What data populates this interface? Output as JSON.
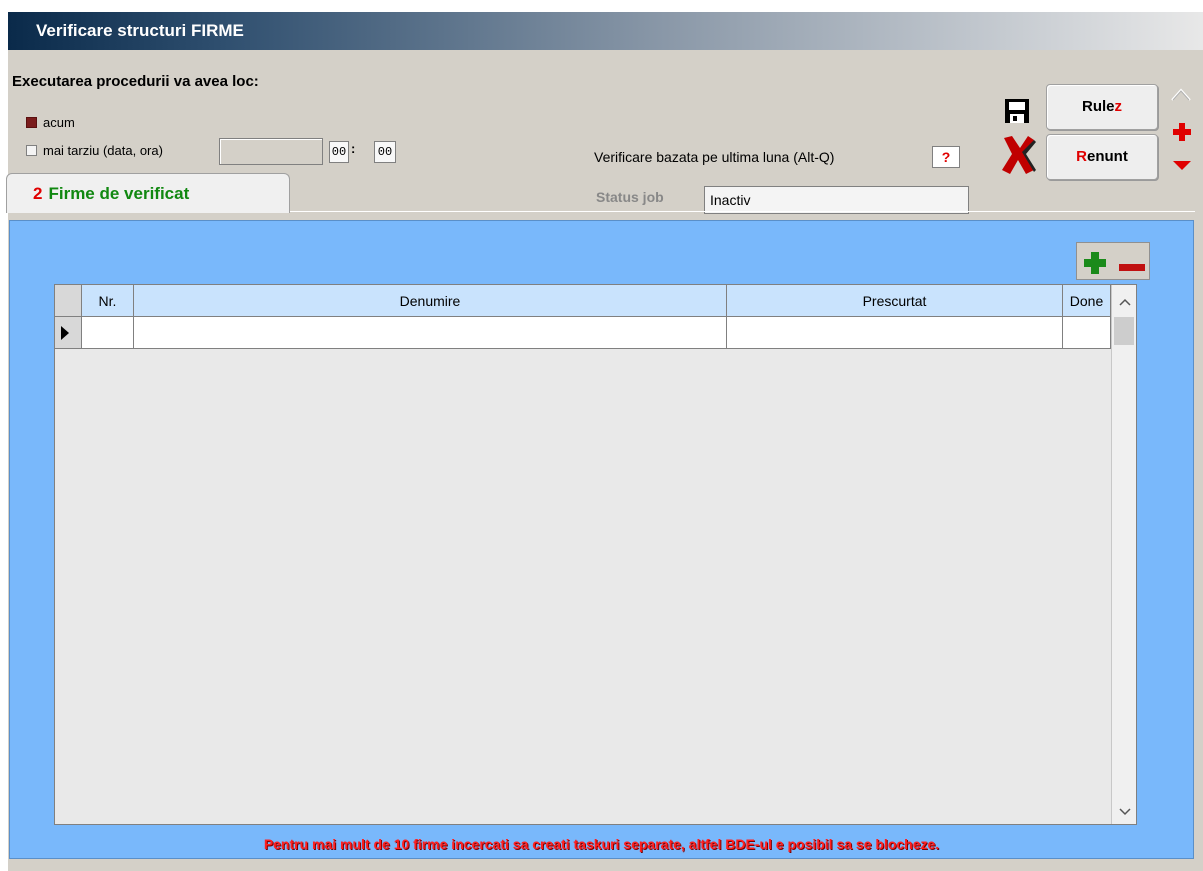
{
  "window": {
    "title": "Verificare structuri FIRME"
  },
  "schedule": {
    "heading": "Executarea procedurii va avea loc:",
    "option_now": "acum",
    "option_later": "mai tarziu (data, ora)",
    "date_value": "",
    "hour_value": "00",
    "minute_value": "00"
  },
  "verification": {
    "label": "Verificare bazata pe ultima luna (Alt-Q)",
    "value": "?"
  },
  "status": {
    "label": "Status job",
    "value": "Inactiv"
  },
  "buttons": {
    "run": {
      "main": "Rule",
      "hotkey": "z"
    },
    "cancel": {
      "hotkey": "R",
      "main": "enunt"
    }
  },
  "tab": {
    "number": "2",
    "label": "Firme de verificat"
  },
  "grid": {
    "columns": [
      "Nr.",
      "Denumire",
      "Prescurtat",
      "Done"
    ],
    "rows": []
  },
  "footer_note": "Pentru mai mult de 10 firme incercati sa creati taskuri separate, altfel BDE-ul e posibil sa se blocheze.",
  "colors": {
    "accent_red": "#e00000",
    "tab_green": "#118811",
    "panel_blue": "#79b8fb",
    "header_blue": "#c9e3fd"
  }
}
